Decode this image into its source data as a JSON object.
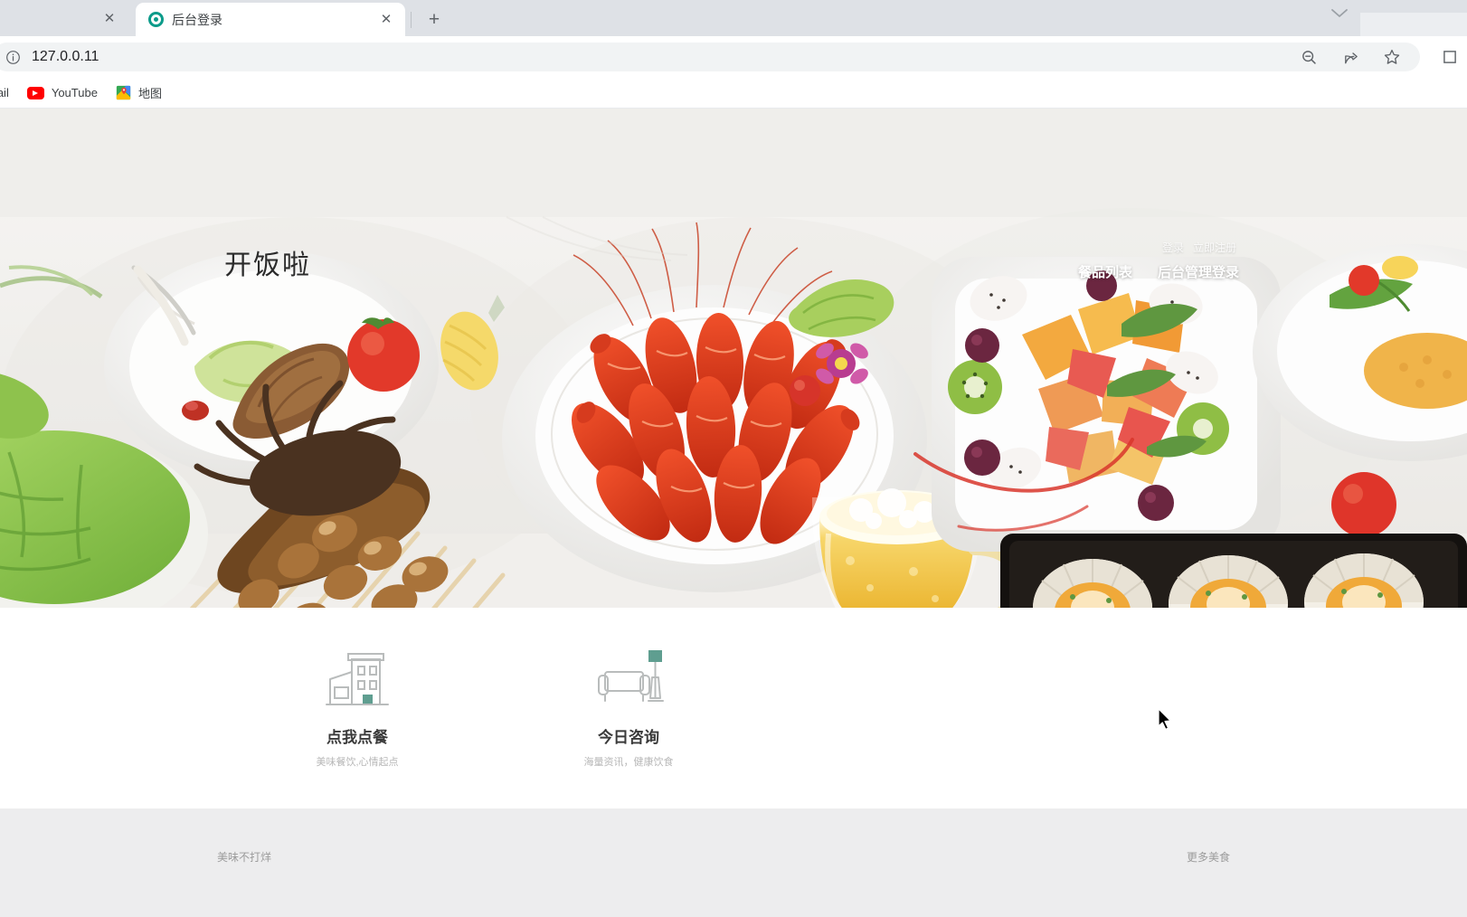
{
  "browser": {
    "tab_close_label": "✕",
    "tabs": [
      {
        "title": "后台登录",
        "favicon": "teal-ring-icon",
        "close_label": "✕"
      }
    ],
    "new_tab_label": "+",
    "window_chevron": "chevron-down-icon",
    "omnibox": {
      "info_icon": "site-info-icon",
      "url": "127.0.0.11",
      "actions": [
        "zoom-out-icon",
        "share-icon",
        "bookmark-star-icon"
      ],
      "extension_icon": "square-extension-icon"
    },
    "bookmarks": [
      {
        "label": "mail",
        "icon": "gmail-icon"
      },
      {
        "label": "YouTube",
        "icon": "youtube-icon"
      },
      {
        "label": "地图",
        "icon": "google-maps-icon"
      }
    ]
  },
  "page": {
    "hero": {
      "brand_title": "开饭啦",
      "auth": {
        "login": "登录",
        "register": "立即注册"
      },
      "nav": [
        {
          "label": "餐品列表"
        },
        {
          "label": "后台管理登录"
        }
      ]
    },
    "features": [
      {
        "icon": "building-icon",
        "title": "点我点餐",
        "desc": "美味餐饮,心情起点"
      },
      {
        "icon": "sofa-lamp-icon",
        "title": "今日咨询",
        "desc": "海量资讯，健康饮食"
      }
    ],
    "footer": {
      "left": "美味不打烊",
      "right": "更多美食"
    }
  },
  "colors": {
    "accent_teal": "#0b9b8a",
    "feature_accent": "#5f9e90",
    "icon_line": "#b9bcbc",
    "footer_bg": "#ededee",
    "text_dark": "#3a3a3a",
    "text_muted": "#b7b7b7"
  }
}
